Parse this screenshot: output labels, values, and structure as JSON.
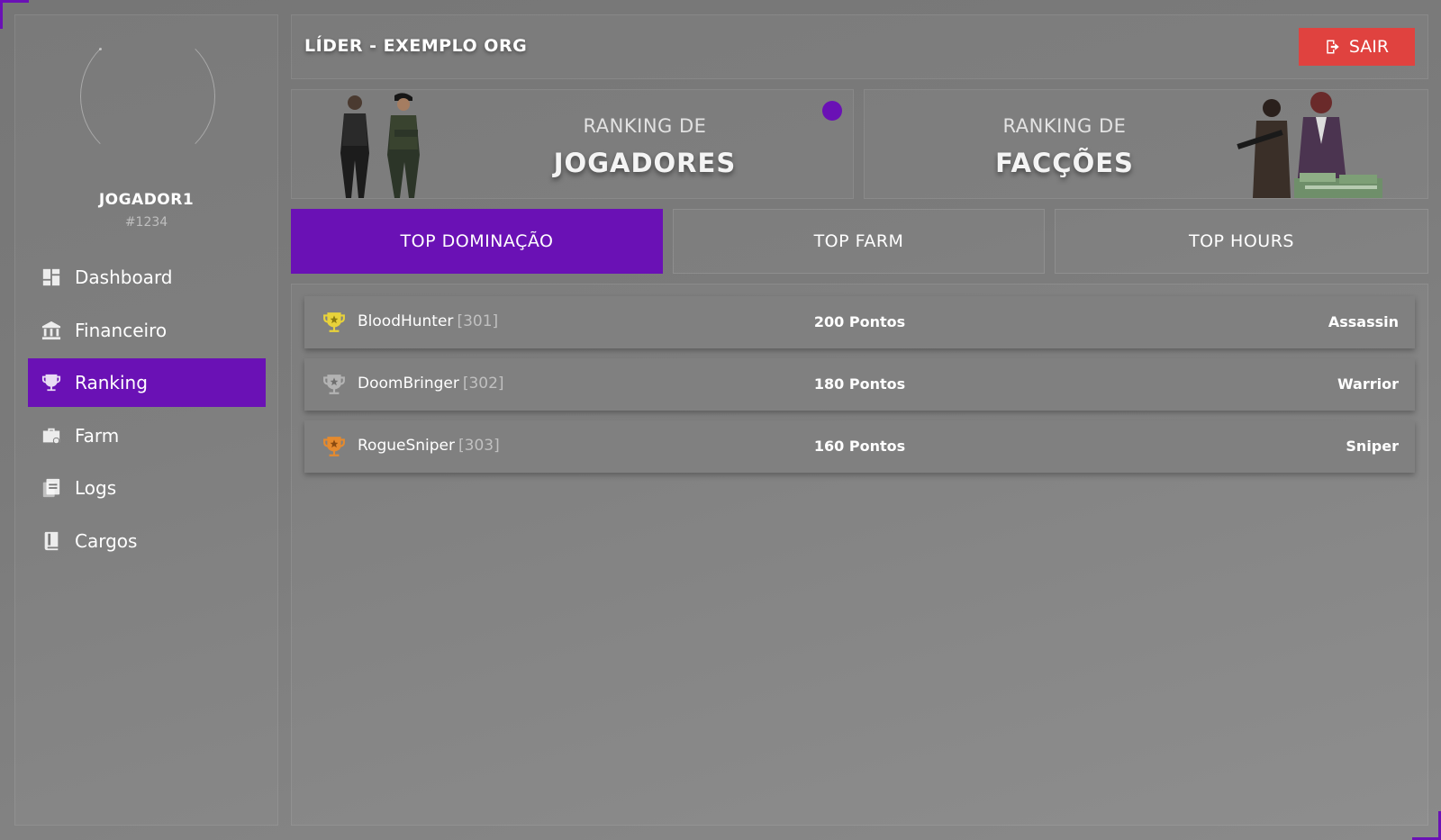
{
  "header": {
    "title": "LÍDER - EXEMPLO ORG",
    "logout_label": "SAIR"
  },
  "user": {
    "name": "JOGADOR1",
    "id": "#1234"
  },
  "sidebar": {
    "items": [
      {
        "label": "Dashboard",
        "icon": "dashboard-icon"
      },
      {
        "label": "Financeiro",
        "icon": "bank-icon"
      },
      {
        "label": "Ranking",
        "icon": "trophy-icon",
        "active": true
      },
      {
        "label": "Farm",
        "icon": "briefcase-icon"
      },
      {
        "label": "Logs",
        "icon": "document-icon"
      },
      {
        "label": "Cargos",
        "icon": "book-icon"
      }
    ]
  },
  "cards": {
    "players": {
      "sub": "RANKING DE",
      "main": "JOGADORES",
      "active": true
    },
    "factions": {
      "sub": "RANKING DE",
      "main": "FACÇÕES"
    }
  },
  "tabs": [
    {
      "label": "TOP DOMINAÇÃO",
      "active": true
    },
    {
      "label": "TOP FARM"
    },
    {
      "label": "TOP HOURS"
    }
  ],
  "ranking": [
    {
      "name": "BloodHunter",
      "id": "[301]",
      "points": "200 Pontos",
      "role": "Assassin",
      "medal": "gold"
    },
    {
      "name": "DoomBringer",
      "id": "[302]",
      "points": "180 Pontos",
      "role": "Warrior",
      "medal": "silver"
    },
    {
      "name": "RogueSniper",
      "id": "[303]",
      "points": "160 Pontos",
      "role": "Sniper",
      "medal": "bronze"
    }
  ],
  "colors": {
    "accent": "#6a11b5",
    "logout": "#e0423f",
    "gold": "#e8d23a",
    "silver": "#b3b3b3",
    "bronze": "#e58a2e"
  }
}
